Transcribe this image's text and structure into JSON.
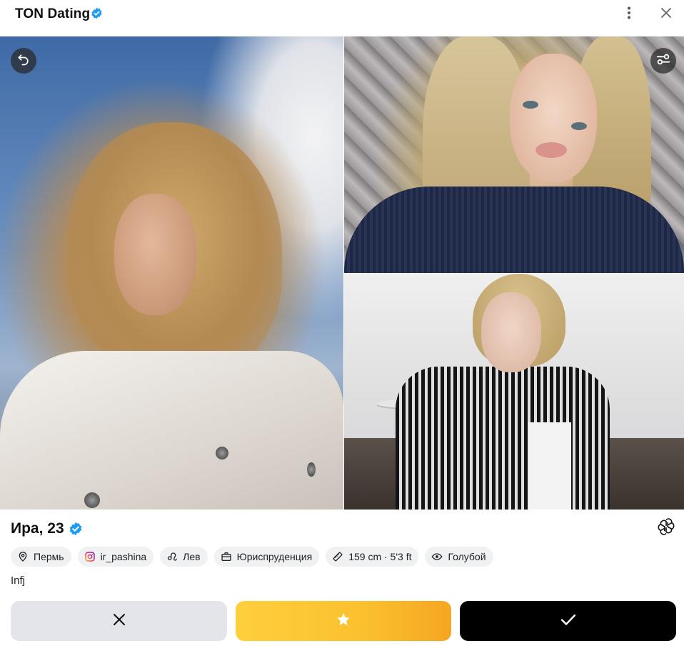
{
  "header": {
    "title": "TON Dating",
    "verified_icon": "verified-badge-icon",
    "more_icon": "more-vertical-icon",
    "close_icon": "close-icon"
  },
  "gallery": {
    "photos": [
      {
        "description_icon": "photo-main"
      },
      {
        "description_icon": "photo-top-right"
      },
      {
        "description_icon": "photo-bottom-right"
      }
    ],
    "undo_icon": "undo-icon",
    "filter_icon": "filter-settings-icon"
  },
  "profile": {
    "name": "Ира, 23",
    "verified_icon": "verified-badge-icon",
    "ai_icon": "openai-icon",
    "bio": "Infj"
  },
  "chips": [
    {
      "icon": "location-pin-icon",
      "label": "Пермь"
    },
    {
      "icon": "instagram-icon",
      "label": "ir_pashina"
    },
    {
      "icon": "leo-zodiac-icon",
      "label": "Лев"
    },
    {
      "icon": "briefcase-icon",
      "label": "Юриспруденция"
    },
    {
      "icon": "ruler-icon",
      "label": "159 cm · 5'3 ft"
    },
    {
      "icon": "eye-icon",
      "label": "Голубой"
    }
  ],
  "actions": {
    "dislike_icon": "x-icon",
    "superlike_icon": "star-icon",
    "like_icon": "check-icon"
  },
  "colors": {
    "verified": "#1d9bf0",
    "superlike_start": "#ffcf3e",
    "superlike_end": "#f5a623",
    "dislike_bg": "#e4e5ea",
    "like_bg": "#000000",
    "chip_bg": "#f0f1f3"
  }
}
